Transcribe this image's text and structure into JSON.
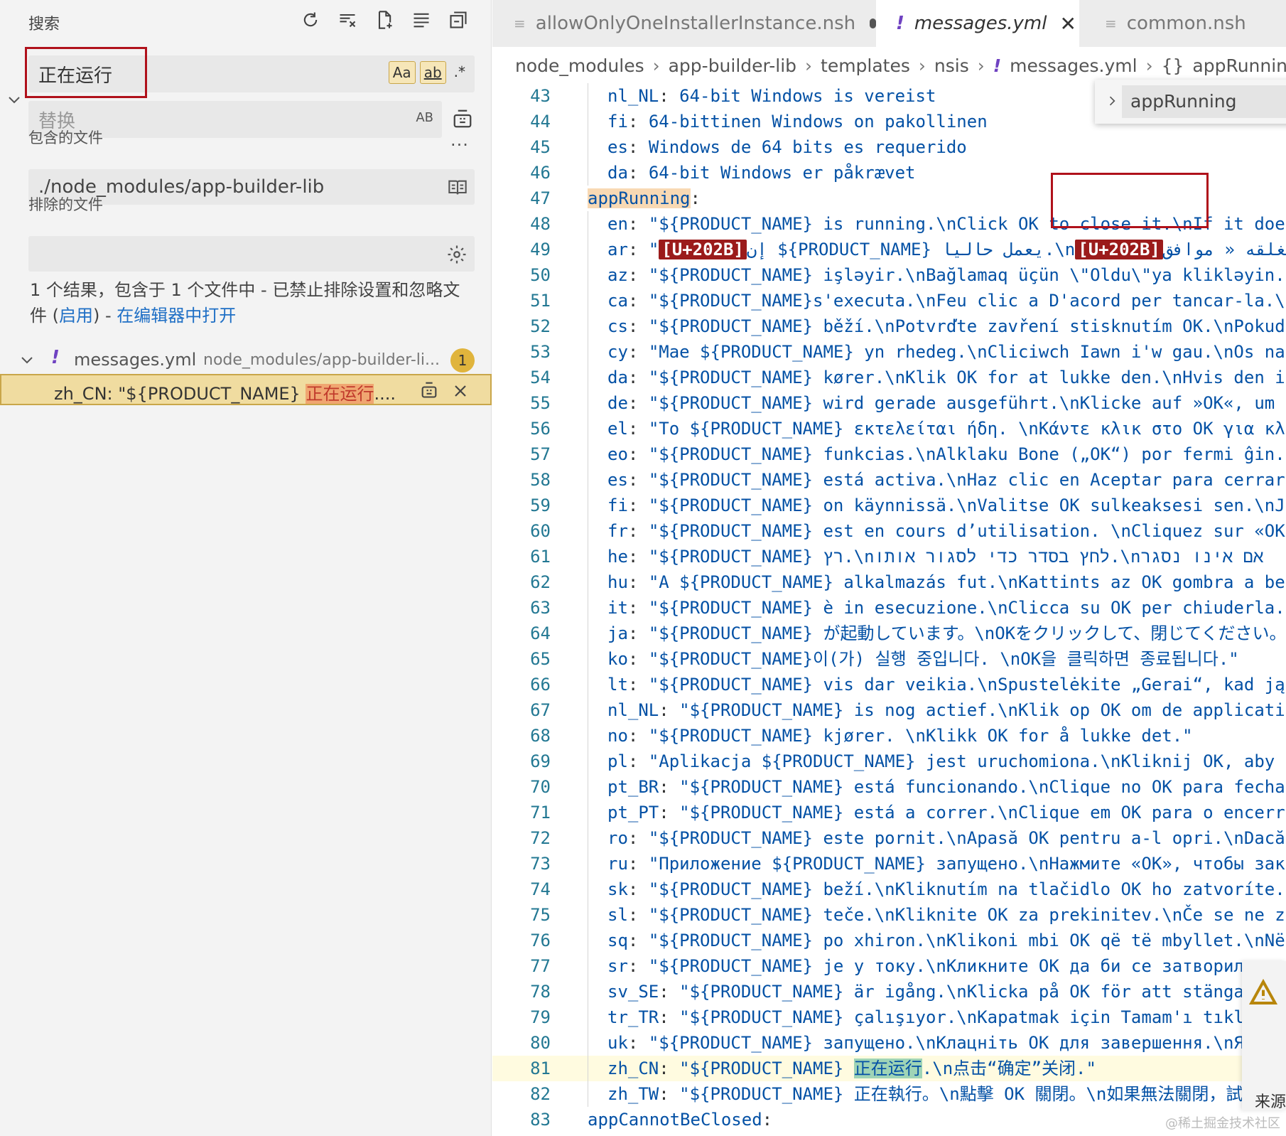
{
  "search_panel": {
    "title": "搜索",
    "search_value": "正在运行",
    "toggle_case": "Aa",
    "toggle_word": "ab",
    "toggle_regex": ".*",
    "replace_placeholder": "替换",
    "replace_preserve_case": "AB",
    "include_label": "包含的文件",
    "include_value": "./node_modules/app-builder-lib",
    "exclude_label": "排除的文件",
    "exclude_value": "",
    "more": "···",
    "result_prefix": "1 个结果，包含于 1 个文件中 - 已禁止排除设置和忽略文件 (",
    "result_enable": "启用",
    "result_mid": ") - ",
    "result_open": "在编辑器中打开",
    "file": {
      "icon": "!",
      "name": "messages.yml",
      "path": "node_modules/app-builder-li...",
      "count": "1"
    },
    "match": {
      "prefix": "zh_CN: \"${PRODUCT_NAME} ",
      "highlight": "正在运行",
      "suffix": "...."
    }
  },
  "tabs": [
    {
      "label": "allowOnlyOneInstallerInstance.nsh",
      "icon": "≡",
      "dirty": true
    },
    {
      "label": "messages.yml",
      "icon": "!",
      "active": true
    },
    {
      "label": "common.nsh",
      "icon": "≡"
    }
  ],
  "breadcrumb": [
    "node_modules",
    "app-builder-lib",
    "templates",
    "nsis",
    "messages.yml",
    "appRunning"
  ],
  "outline": {
    "item": "appRunning"
  },
  "code_lines": [
    {
      "n": "43",
      "key": "nl_NL",
      "val": "64-bit Windows is vereist"
    },
    {
      "n": "44",
      "key": "fi",
      "val": "64-bittinen Windows on pakollinen"
    },
    {
      "n": "45",
      "key": "es",
      "val": "Windows de 64 bits es requerido"
    },
    {
      "n": "46",
      "key": "da",
      "val": "64-bit Windows er påkrævet"
    },
    {
      "n": "47",
      "key": "appRunning",
      "val": "",
      "top": true
    },
    {
      "n": "48",
      "key": "en",
      "val": "\"${PRODUCT_NAME} is running.\\nClick OK to close it.\\nIf it doe"
    },
    {
      "n": "49",
      "key": "ar",
      "val": "\"[U+202B]إن ${PRODUCT_NAME} يعمل حاليا.\\n[U+202B]لغلقه « موافق"
    },
    {
      "n": "50",
      "key": "az",
      "val": "\"${PRODUCT_NAME} işləyir.\\nBağlamaq üçün \\\"Oldu\\\"ya klikləyin."
    },
    {
      "n": "51",
      "key": "ca",
      "val": "\"${PRODUCT_NAME}s'executa.\\nFeu clic a D'acord per tancar-la.\\"
    },
    {
      "n": "52",
      "key": "cs",
      "val": "\"${PRODUCT_NAME} běží.\\nPotvrďte zavření stisknutím OK.\\nPokud"
    },
    {
      "n": "53",
      "key": "cy",
      "val": "\"Mae ${PRODUCT_NAME} yn rhedeg.\\nCliciwch Iawn i'w gau.\\nOs na"
    },
    {
      "n": "54",
      "key": "da",
      "val": "\"${PRODUCT_NAME} kører.\\nKlik OK for at lukke den.\\nHvis den i"
    },
    {
      "n": "55",
      "key": "de",
      "val": "\"${PRODUCT_NAME} wird gerade ausgeführt.\\nKlicke auf »OK«, um"
    },
    {
      "n": "56",
      "key": "el",
      "val": "\"Το ${PRODUCT_NAME} εκτελείται ήδη. \\nΚάντε κλικ στο OK για κλ"
    },
    {
      "n": "57",
      "key": "eo",
      "val": "\"${PRODUCT_NAME} funkcias.\\nAlklaku Bone („OK“) por fermi ĝin."
    },
    {
      "n": "58",
      "key": "es",
      "val": "\"${PRODUCT_NAME} está activa.\\nHaz clic en Aceptar para cerrar"
    },
    {
      "n": "59",
      "key": "fi",
      "val": "\"${PRODUCT_NAME} on käynnissä.\\nValitse OK sulkeaksesi sen.\\nJ"
    },
    {
      "n": "60",
      "key": "fr",
      "val": "\"${PRODUCT_NAME} est en cours d’utilisation. \\nCliquez sur «OK"
    },
    {
      "n": "61",
      "key": "he",
      "val": "\"${PRODUCT_NAME} רץ.\\nלחץ בסדר כדי לסגור אותו.\\nאם אינו נסגר"
    },
    {
      "n": "62",
      "key": "hu",
      "val": "\"A ${PRODUCT_NAME} alkalmazás fut.\\nKattints az OK gombra a be"
    },
    {
      "n": "63",
      "key": "it",
      "val": "\"${PRODUCT_NAME} è in esecuzione.\\nClicca su OK per chiuderla."
    },
    {
      "n": "64",
      "key": "ja",
      "val": "\"${PRODUCT_NAME} が起動しています。\\nOKをクリックして、閉じてください。"
    },
    {
      "n": "65",
      "key": "ko",
      "val": "\"${PRODUCT_NAME}이(가) 실행 중입니다. \\nOK을 클릭하면 종료됩니다.\""
    },
    {
      "n": "66",
      "key": "lt",
      "val": "\"${PRODUCT_NAME} vis dar veikia.\\nSpustelėkite „Gerai“, kad ją"
    },
    {
      "n": "67",
      "key": "nl_NL",
      "val": "\"${PRODUCT_NAME} is nog actief.\\nKlik op OK om de applicati"
    },
    {
      "n": "68",
      "key": "no",
      "val": "\"${PRODUCT_NAME} kjører. \\nKlikk OK for å lukke det.\""
    },
    {
      "n": "69",
      "key": "pl",
      "val": "\"Aplikacja ${PRODUCT_NAME} jest uruchomiona.\\nKliknij OK, aby"
    },
    {
      "n": "70",
      "key": "pt_BR",
      "val": "\"${PRODUCT_NAME} está funcionando.\\nClique no OK para fecha"
    },
    {
      "n": "71",
      "key": "pt_PT",
      "val": "\"${PRODUCT_NAME} está a correr.\\nClique em OK para o encerr"
    },
    {
      "n": "72",
      "key": "ro",
      "val": "\"${PRODUCT_NAME} este pornit.\\nApasă OK pentru a-l opri.\\nDacă"
    },
    {
      "n": "73",
      "key": "ru",
      "val": "\"Приложение ${PRODUCT_NAME} запущено.\\nНажмите «OK», чтобы зак"
    },
    {
      "n": "74",
      "key": "sk",
      "val": "\"${PRODUCT_NAME} beží.\\nKliknutím na tlačidlo OK ho zatvoríte."
    },
    {
      "n": "75",
      "key": "sl",
      "val": "\"${PRODUCT_NAME} teče.\\nKliknite OK za prekinitev.\\nČe se ne z"
    },
    {
      "n": "76",
      "key": "sq",
      "val": "\"${PRODUCT_NAME} po xhiron.\\nKlikoni mbi OK që të mbyllet.\\nNë"
    },
    {
      "n": "77",
      "key": "sr",
      "val": "\"${PRODUCT_NAME} је у току.\\nКликните OK да би се затворил"
    },
    {
      "n": "78",
      "key": "sv_SE",
      "val": "\"${PRODUCT_NAME} är igång.\\nKlicka på OK för att stänga"
    },
    {
      "n": "79",
      "key": "tr_TR",
      "val": "\"${PRODUCT_NAME} çalışıyor.\\nKapatmak için Tamam'ı tıkl"
    },
    {
      "n": "80",
      "key": "uk",
      "val": "\"${PRODUCT_NAME} запущено.\\nКлацніть OK для завершення.\\nЯ"
    },
    {
      "n": "81",
      "key": "zh_CN",
      "val_pre": "\"${PRODUCT_NAME} ",
      "val_hl": "正在运行",
      "val_post": ".\\n点击“确定”关闭.\"",
      "highlighted": true
    },
    {
      "n": "82",
      "key": "zh_TW",
      "val": "\"${PRODUCT_NAME} 正在執行。\\n點擊 OK 關閉。\\n如果無法關閉，試"
    },
    {
      "n": "83",
      "key": "appCannotBeClosed",
      "val": "",
      "top": true
    }
  ],
  "side_panel": {
    "warn_icon": "warning-icon",
    "source_text": "来源"
  },
  "watermark": "@稀土掘金技术社区",
  "colors": {
    "accent_outline": "#b0111b",
    "match_highlight": "#9fd4b6",
    "key_highlight": "#f8d9b4",
    "unicode_badge": "#9b1b1b",
    "line_numbers": "#237893",
    "yaml_key": "#0451a5"
  }
}
